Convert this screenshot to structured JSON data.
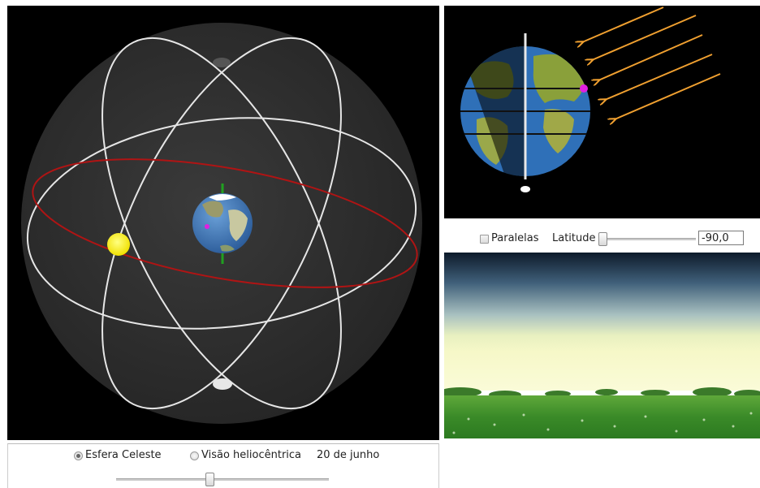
{
  "latitude_controls": {
    "paralelas_label": "Paralelas",
    "paralelas_checked": false,
    "latitude_label": "Latitude",
    "latitude_value": "-90,0",
    "latitude_slider_fraction": 0.0
  },
  "view_controls": {
    "options": [
      {
        "label": "Esfera Celeste",
        "selected": true
      },
      {
        "label": "Visão heliocêntrica",
        "selected": false
      }
    ],
    "date_label": "20 de junho",
    "date_slider_fraction": 0.44
  },
  "colors": {
    "background": "#000000",
    "ecliptic": "#b01414",
    "sun": "#f5e600",
    "sun_rays": "#f0a030",
    "observer_marker": "#e020e0",
    "earth_axis": "#20a020"
  },
  "icons": {
    "sun": "sun-icon",
    "earth": "earth-icon"
  }
}
